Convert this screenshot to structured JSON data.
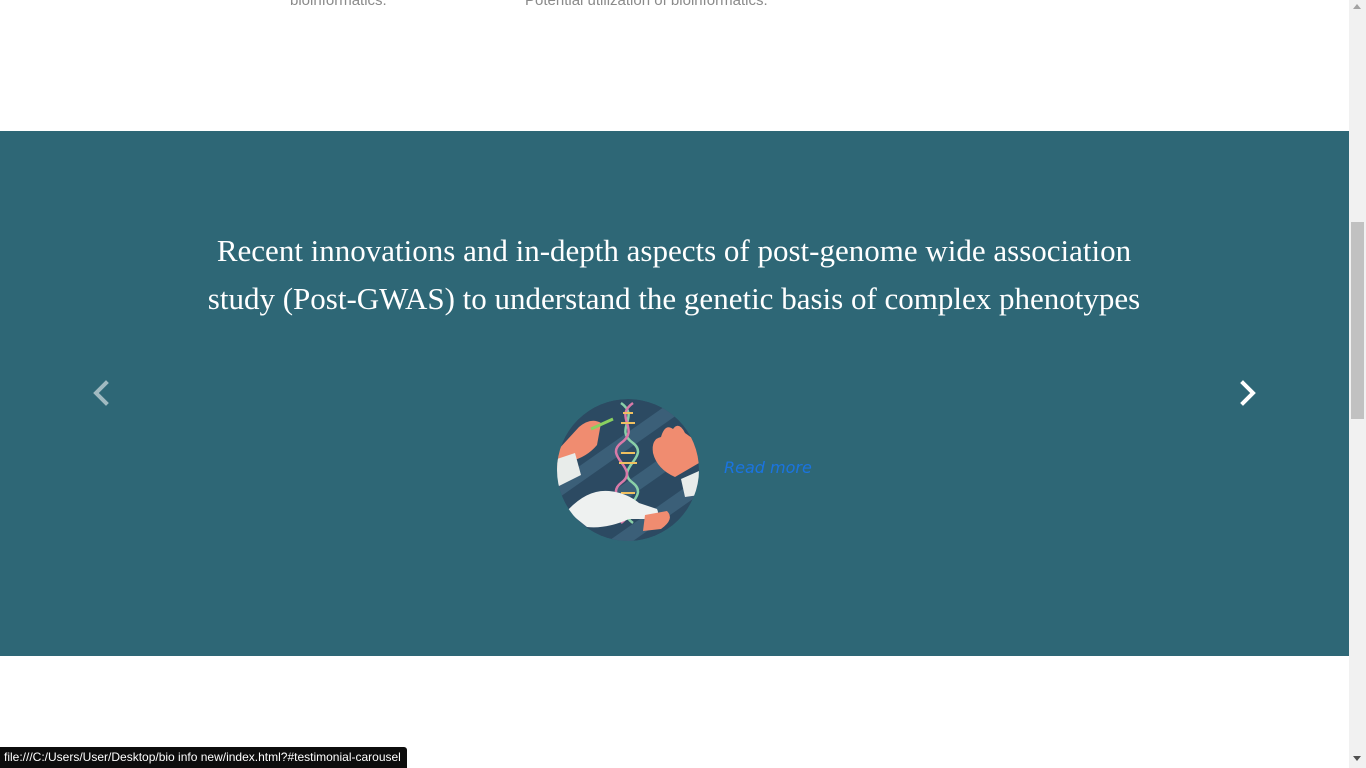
{
  "previous_section": {
    "left_text": "bioinformatics.",
    "right_text": "Potential utilization of bioinformatics."
  },
  "carousel": {
    "title": "Recent innovations and in-depth aspects of post-genome wide association study (Post-GWAS) to understand the genetic basis of complex phenotypes",
    "read_more_label": "Read more",
    "background_color": "#2e6776",
    "prev_icon": "chevron-left-icon",
    "next_icon": "chevron-right-icon",
    "image_icon": "dna-hands-illustration"
  },
  "status_bar": {
    "url": "file:///C:/Users/User/Desktop/bio info new/index.html?#testimonial-carousel"
  }
}
